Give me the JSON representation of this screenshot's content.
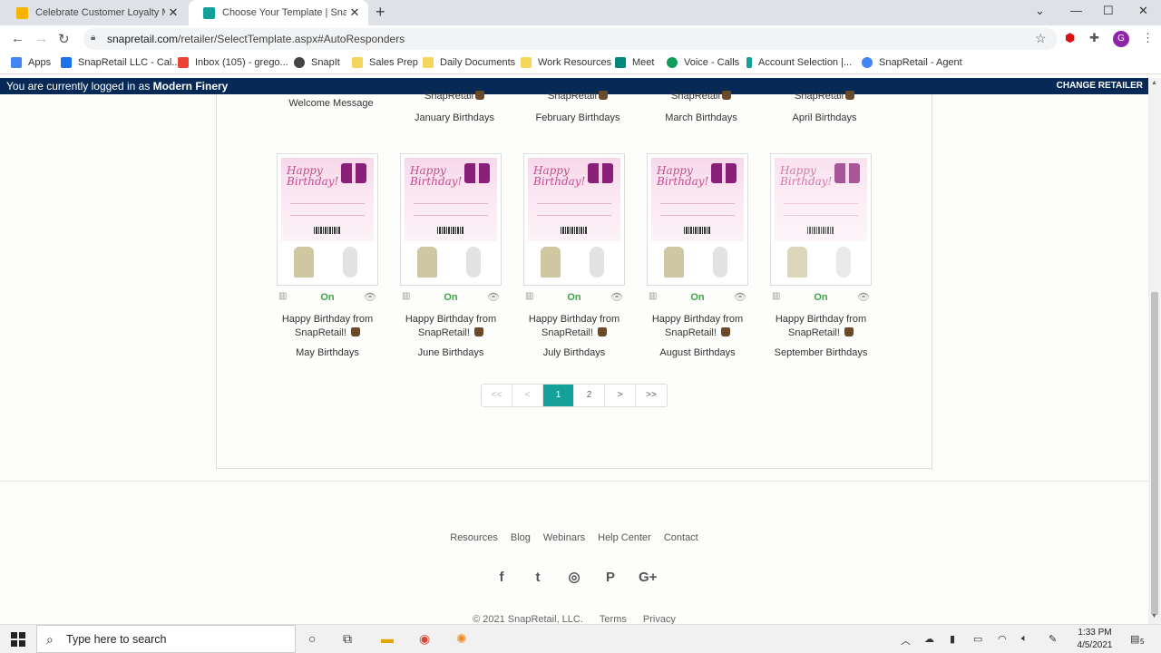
{
  "browser": {
    "tabs": [
      {
        "title": "Celebrate Customer Loyalty Mon",
        "active": false,
        "icon": "google-slides-icon",
        "color": "#f4b400"
      },
      {
        "title": "Choose Your Template | SnapRet",
        "active": true,
        "icon": "snapretail-icon",
        "color": "#16a09a"
      }
    ],
    "url_domain": "snapretail.com",
    "url_path": "/retailer/SelectTemplate.aspx#AutoResponders",
    "profile_initial": "G"
  },
  "bookmarks": [
    {
      "label": "Apps",
      "icon": "apps-grid-icon",
      "color": "#4285f4"
    },
    {
      "label": "SnapRetail LLC - Cal...",
      "icon": "calendar-icon",
      "color": "#1a73e8"
    },
    {
      "label": "Inbox (105) - grego...",
      "icon": "gmail-icon",
      "color": "#ea4335"
    },
    {
      "label": "SnapIt",
      "icon": "snapit-icon",
      "color": "#444444"
    },
    {
      "label": "Sales Prep",
      "icon": "folder-icon",
      "color": "#f6d55c"
    },
    {
      "label": "Daily Documents",
      "icon": "folder-icon",
      "color": "#f6d55c"
    },
    {
      "label": "Work Resources",
      "icon": "folder-icon",
      "color": "#f6d55c"
    },
    {
      "label": "Meet",
      "icon": "meet-icon",
      "color": "#00897b"
    },
    {
      "label": "Voice - Calls",
      "icon": "phone-icon",
      "color": "#0f9d58"
    },
    {
      "label": "Account Selection |...",
      "icon": "snapretail-icon",
      "color": "#16a09a"
    },
    {
      "label": "SnapRetail - Agent",
      "icon": "google-icon",
      "color": "#4285f4"
    }
  ],
  "banner": {
    "prefix": "You are currently logged in as",
    "retailer": "Modern Finery",
    "change": "CHANGE RETAILER"
  },
  "top_row": [
    {
      "name": "",
      "schedule": "Welcome Message"
    },
    {
      "name": "SnapRetail",
      "schedule": "January Birthdays"
    },
    {
      "name": "SnapRetail",
      "schedule": "February Birthdays"
    },
    {
      "name": "SnapRetail",
      "schedule": "March Birthdays"
    },
    {
      "name": "SnapRetail",
      "schedule": "April Birthdays"
    }
  ],
  "templates": [
    {
      "heading": "Happy Birthday!",
      "status": "On",
      "name_line1": "Happy Birthday from",
      "name_line2": "SnapRetail!",
      "schedule": "May Birthdays"
    },
    {
      "heading": "Happy Birthday!",
      "status": "On",
      "name_line1": "Happy Birthday from",
      "name_line2": "SnapRetail!",
      "schedule": "June Birthdays"
    },
    {
      "heading": "Happy Birthday!",
      "status": "On",
      "name_line1": "Happy Birthday from",
      "name_line2": "SnapRetail!",
      "schedule": "July Birthdays"
    },
    {
      "heading": "Happy Birthday!",
      "status": "On",
      "name_line1": "Happy Birthday from",
      "name_line2": "SnapRetail!",
      "schedule": "August Birthdays"
    },
    {
      "heading": "Happy Birthday!",
      "status": "On",
      "name_line1": "Happy Birthday from",
      "name_line2": "SnapRetail!",
      "schedule": "September Birthdays"
    }
  ],
  "pagination": {
    "first": "<<",
    "prev": "<",
    "pages": [
      "1",
      "2"
    ],
    "current": "1",
    "next": ">",
    "last": ">>"
  },
  "footer": {
    "links": [
      "Resources",
      "Blog",
      "Webinars",
      "Help Center",
      "Contact"
    ],
    "social": [
      {
        "glyph": "f",
        "icon": "facebook-icon"
      },
      {
        "glyph": "t",
        "icon": "twitter-icon"
      },
      {
        "glyph": "◎",
        "icon": "instagram-icon"
      },
      {
        "glyph": "P",
        "icon": "pinterest-icon"
      },
      {
        "glyph": "G+",
        "icon": "google-plus-icon"
      }
    ],
    "copyright": "© 2021 SnapRetail, LLC.",
    "terms": "Terms",
    "privacy": "Privacy"
  },
  "taskbar": {
    "search_placeholder": "Type here to search",
    "time": "1:33 PM",
    "date": "4/5/2021",
    "notification_count": "5"
  },
  "colors": {
    "accent": "#16a09a",
    "banner": "#062a55",
    "status_on": "#3ca24a"
  }
}
